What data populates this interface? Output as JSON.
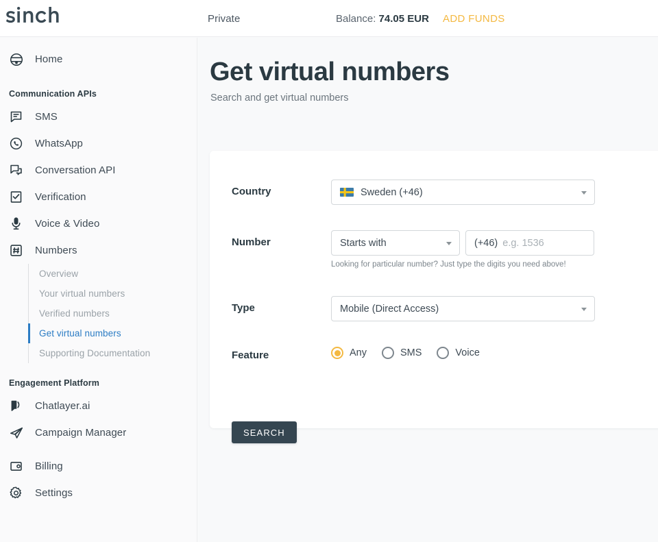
{
  "header": {
    "logo_text": "sinch",
    "account_label": "Private",
    "balance_prefix": "Balance:",
    "balance_value": "74.05 EUR",
    "add_funds_label": "ADD FUNDS",
    "add_funds_color": "#f4b942"
  },
  "sidebar": {
    "home": {
      "label": "Home",
      "icon": "home-icon"
    },
    "sections": [
      {
        "title": "Communication APIs",
        "items": [
          {
            "label": "SMS",
            "icon": "sms-icon"
          },
          {
            "label": "WhatsApp",
            "icon": "whatsapp-icon"
          },
          {
            "label": "Conversation API",
            "icon": "conversation-icon"
          },
          {
            "label": "Verification",
            "icon": "verification-icon"
          },
          {
            "label": "Voice & Video",
            "icon": "microphone-icon"
          },
          {
            "label": "Numbers",
            "icon": "hash-icon"
          }
        ],
        "subnav": [
          {
            "label": "Overview",
            "active": false
          },
          {
            "label": "Your virtual numbers",
            "active": false
          },
          {
            "label": "Verified numbers",
            "active": false
          },
          {
            "label": "Get virtual numbers",
            "active": true
          },
          {
            "label": "Supporting Documentation",
            "active": false
          }
        ]
      },
      {
        "title": "Engagement Platform",
        "items": [
          {
            "label": "Chatlayer.ai",
            "icon": "chat-bubble-icon"
          },
          {
            "label": "Campaign Manager",
            "icon": "paper-plane-icon"
          }
        ]
      }
    ],
    "footer_items": [
      {
        "label": "Billing",
        "icon": "wallet-icon"
      },
      {
        "label": "Settings",
        "icon": "gear-icon"
      }
    ],
    "active_color": "#2b7cc4"
  },
  "page": {
    "title": "Get virtual numbers",
    "subtitle": "Search and get virtual numbers"
  },
  "form": {
    "country": {
      "label": "Country",
      "value": "Sweden (+46)",
      "flag": "sweden-flag-icon"
    },
    "number": {
      "label": "Number",
      "match_mode": "Starts with",
      "prefix": "(+46)",
      "placeholder": "e.g. 1536",
      "value": "",
      "hint": "Looking for particular number? Just type the digits you need above!"
    },
    "type": {
      "label": "Type",
      "value": "Mobile (Direct Access)"
    },
    "feature": {
      "label": "Feature",
      "options": [
        {
          "label": "Any",
          "selected": true
        },
        {
          "label": "SMS",
          "selected": false
        },
        {
          "label": "Voice",
          "selected": false
        }
      ],
      "selected_color": "#f4b942"
    },
    "search_button": "SEARCH"
  }
}
